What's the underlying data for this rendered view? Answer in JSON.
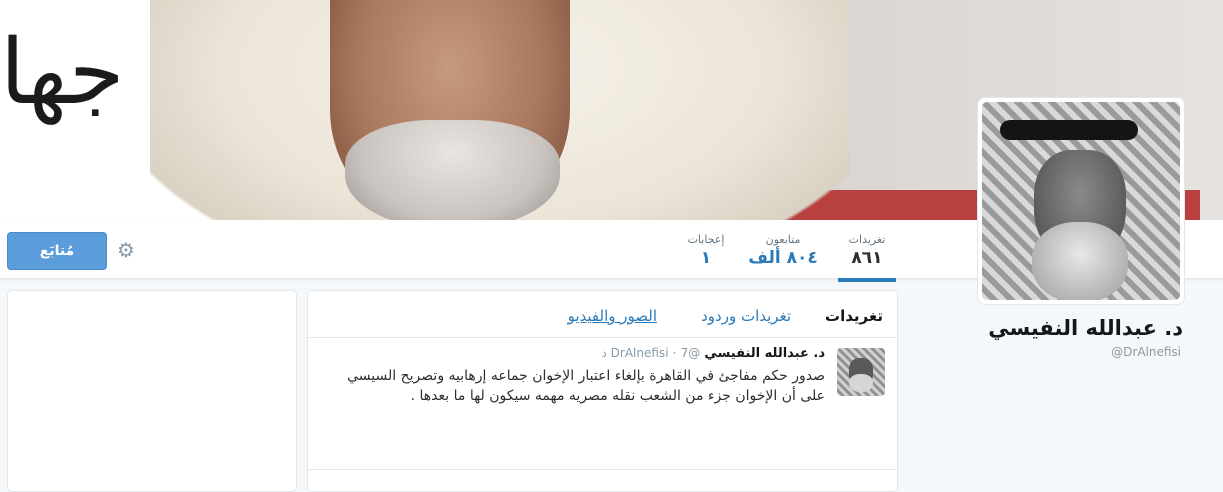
{
  "banner": {
    "wall_text": "جها"
  },
  "profile": {
    "name": "د. عبدالله النفيسي",
    "handle": "@DrAlnefisi"
  },
  "nav": {
    "follow_label": "مُتابَع",
    "stats": [
      {
        "label": "تغريدات",
        "value": "٨٦١"
      },
      {
        "label": "متابعون",
        "value": "٨٠٤ ألف"
      },
      {
        "label": "إعجابات",
        "value": "١"
      }
    ]
  },
  "timeline": {
    "tabs": [
      "تغريدات",
      "تغريدات وردود",
      "الصور والفيديو"
    ],
    "tweet": {
      "name": "د. عبدالله النفيسي",
      "handle": "@DrAlnefisi",
      "separator": "·",
      "time": "7 د",
      "text": "صدور حكم مفاجئ في القاهرة بإلغاء اعتبار الإخوان جماعه إرهابيه وتصريح السيسي على أن الإخوان جزء من الشعب نقله مصريه مهمه سيكون لها ما بعدها ."
    }
  },
  "icons": {
    "gear": "gear-icon"
  },
  "colors": {
    "accent": "#2b7bb9",
    "follow_button": "#5b9cdb"
  }
}
